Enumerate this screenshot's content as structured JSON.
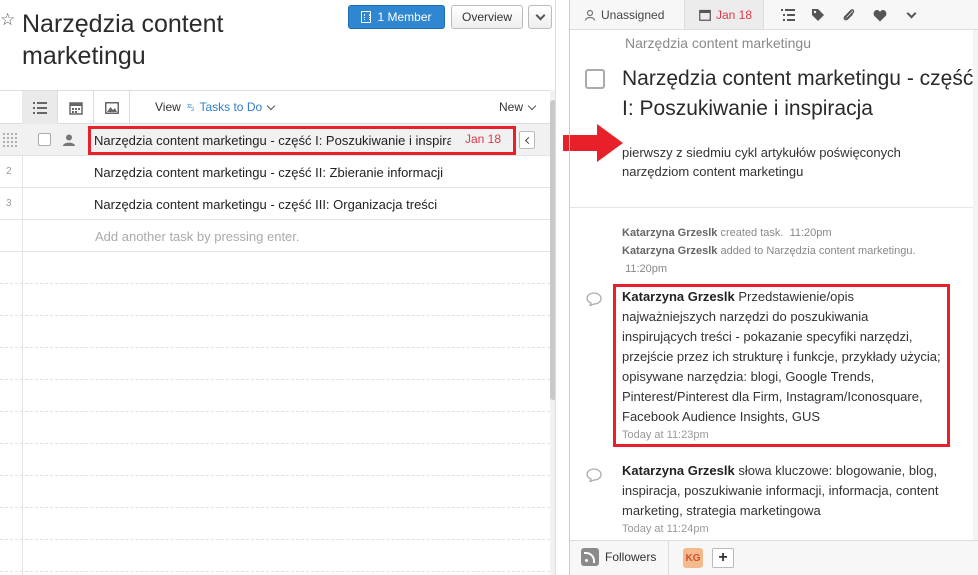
{
  "project": {
    "title": "Narzędzia content marketingu",
    "member_button": "1 Member",
    "overview_button": "Overview"
  },
  "toolbar": {
    "view_label": "View",
    "view_num": "¹²₃",
    "view_value": "Tasks to Do",
    "new_label": "New"
  },
  "tasks": [
    {
      "num": "",
      "name": "Narzędzia content marketingu - część I: Poszukiwanie i inspiracja",
      "due": "Jan 18"
    },
    {
      "num": "2",
      "name": "Narzędzia content marketingu - część II: Zbieranie informacji"
    },
    {
      "num": "3",
      "name": "Narzędzia content marketingu - część III: Organizacja treści"
    }
  ],
  "add_task_placeholder": "Add another task by pressing enter.",
  "detail": {
    "assignee": "Unassigned",
    "due": "Jan 18",
    "breadcrumb": "Narzędzia content marketingu",
    "title": "Narzędzia content marketingu - część I: Poszukiwanie i inspiracja",
    "description": "pierwszy z siedmiu cykl artykułów poświęconych narzędziom content marketingu",
    "stories": [
      {
        "author": "Katarzyna Grzeslk",
        "text": "created task.",
        "time": "11:20pm"
      },
      {
        "author": "Katarzyna Grzeslk",
        "text": "added to Narzędzia content marketingu.",
        "time": "11:20pm"
      }
    ],
    "comments": [
      {
        "author": "Katarzyna Grzeslk",
        "text": "Przedstawienie/opis najważniejszych narzędzi do poszukiwania inspirujących treści - pokazanie specyfiki narzędzi, przejście przez ich strukturę i funkcje, przykłady użycia; opisywane narzędzia: blogi, Google Trends, Pinterest/Pinterest dla Firm, Instagram/Iconosquare, Facebook Audience Insights, GUS",
        "time": "Today at 11:23pm"
      },
      {
        "author": "Katarzyna Grzeslk",
        "text": "słowa kluczowe: blogowanie, blog, inspiracja, poszukiwanie informacji, informacja, content marketing, strategia marketingowa",
        "time": "Today at 11:24pm"
      }
    ],
    "followers_label": "Followers",
    "follower_initials": "KG",
    "add_follower": "+"
  },
  "colors": {
    "accent": "#2f86d1",
    "highlight": "#e8202a",
    "due": "#e0394a"
  }
}
